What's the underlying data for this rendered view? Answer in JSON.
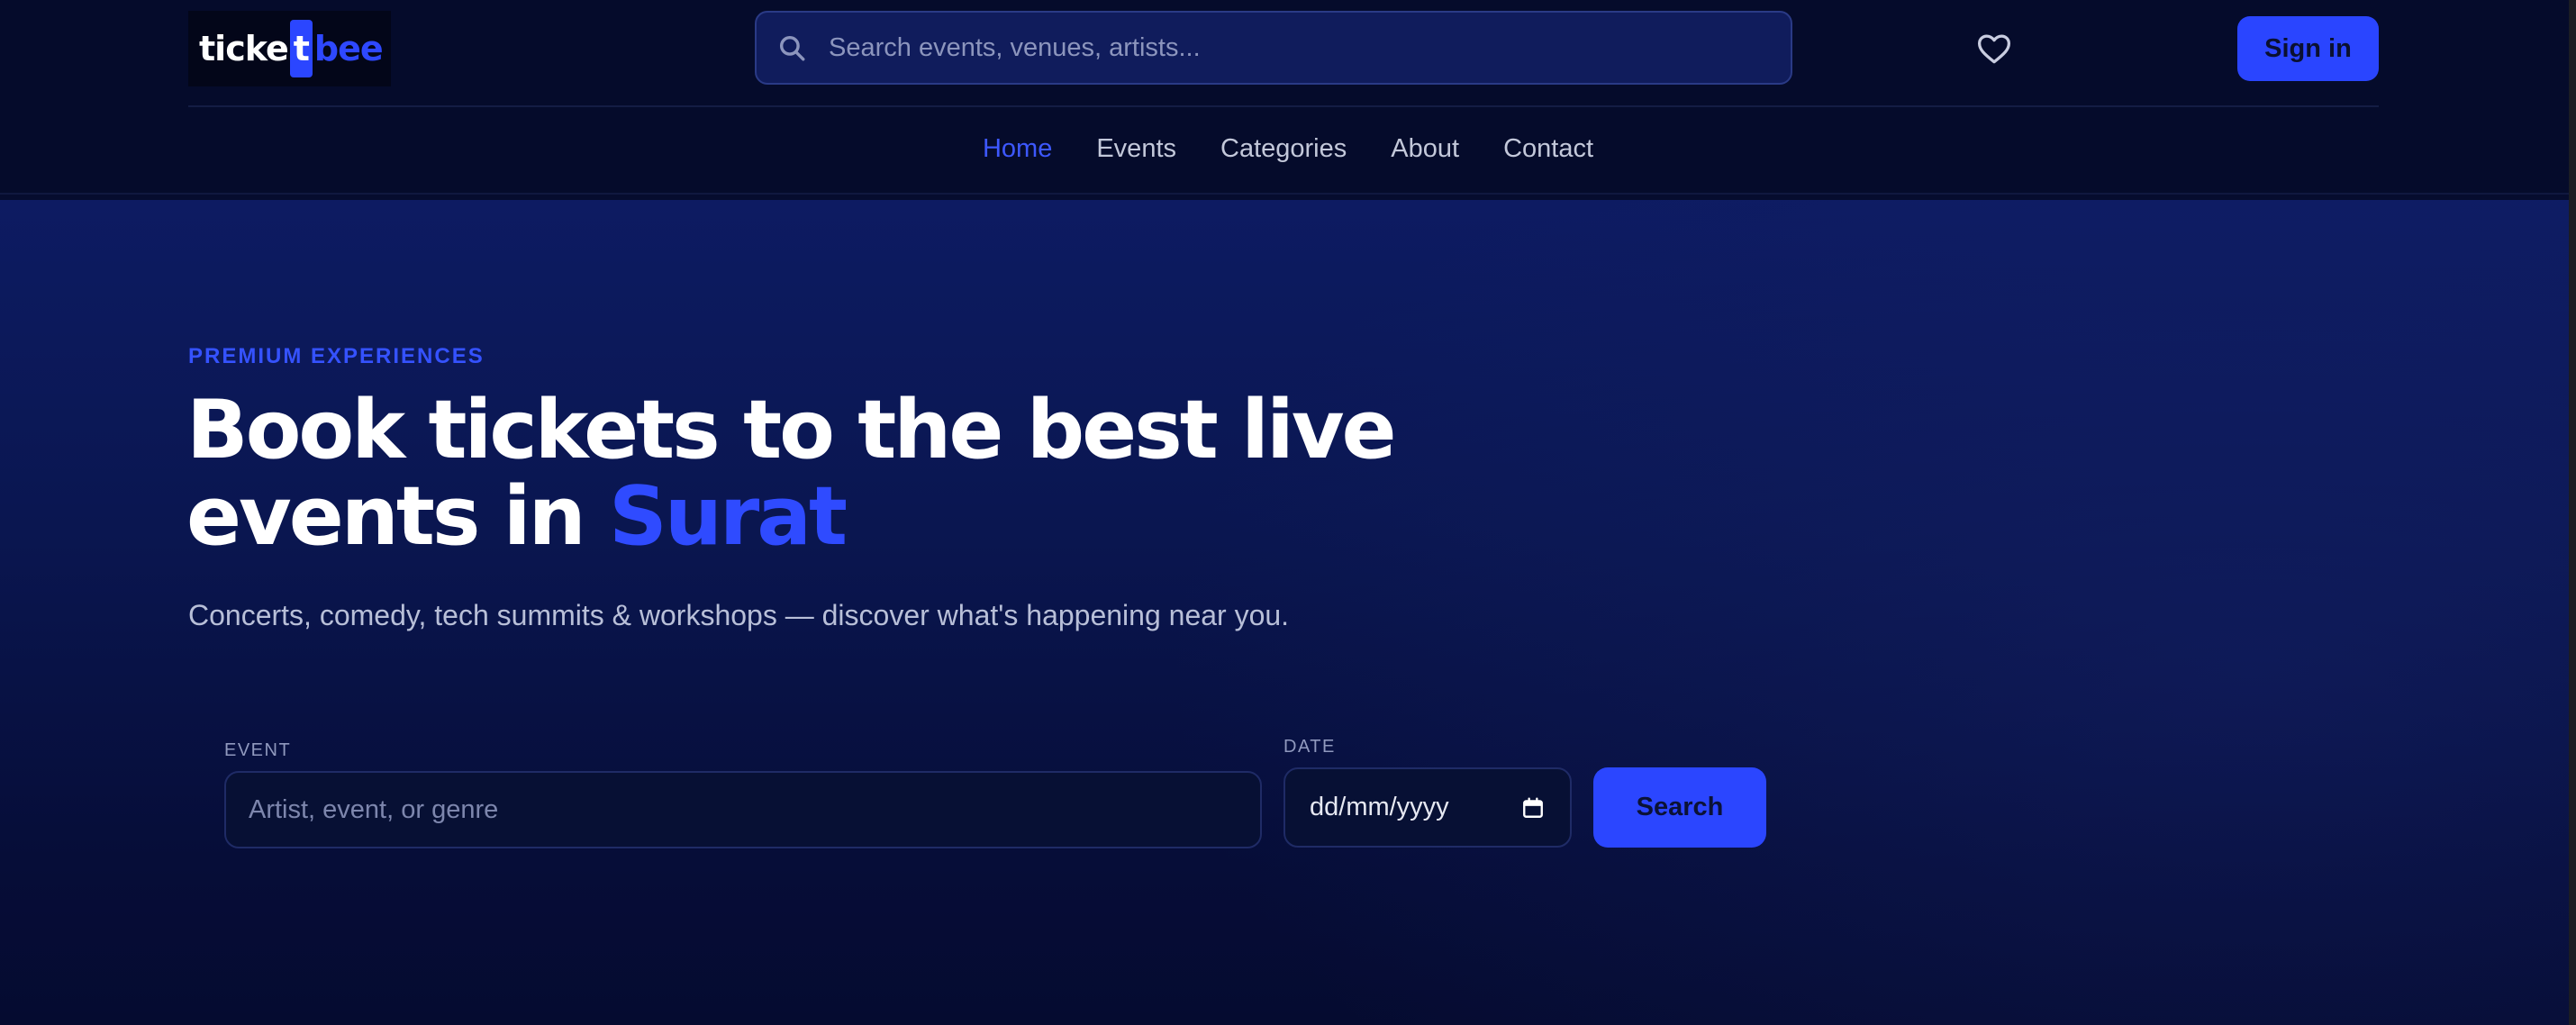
{
  "header": {
    "logo": {
      "part_a": "ticke",
      "part_t": "t",
      "part_b": "bee"
    },
    "search_placeholder": "Search events, venues, artists...",
    "signin_label": "Sign in"
  },
  "nav": {
    "items": [
      {
        "label": "Home",
        "active": true
      },
      {
        "label": "Events",
        "active": false
      },
      {
        "label": "Categories",
        "active": false
      },
      {
        "label": "About",
        "active": false
      },
      {
        "label": "Contact",
        "active": false
      }
    ]
  },
  "hero": {
    "eyebrow": "PREMIUM EXPERIENCES",
    "headline_line1": "Book tickets to the best live",
    "headline_line2_prefix": "events in ",
    "headline_city": "Surat",
    "subtitle": "Concerts, comedy, tech summits & workshops — discover what's happening near you."
  },
  "search_form": {
    "event_label": "EVENT",
    "event_placeholder": "Artist, event, or genre",
    "date_label": "DATE",
    "date_placeholder": "dd/mm/yyyy",
    "submit_label": "Search"
  },
  "icons": {
    "search": "search-icon",
    "heart": "heart-icon",
    "calendar": "calendar-icon"
  },
  "colors": {
    "accent": "#2b46ff",
    "nav_active": "#3d58ff",
    "background": "#060c2e"
  }
}
